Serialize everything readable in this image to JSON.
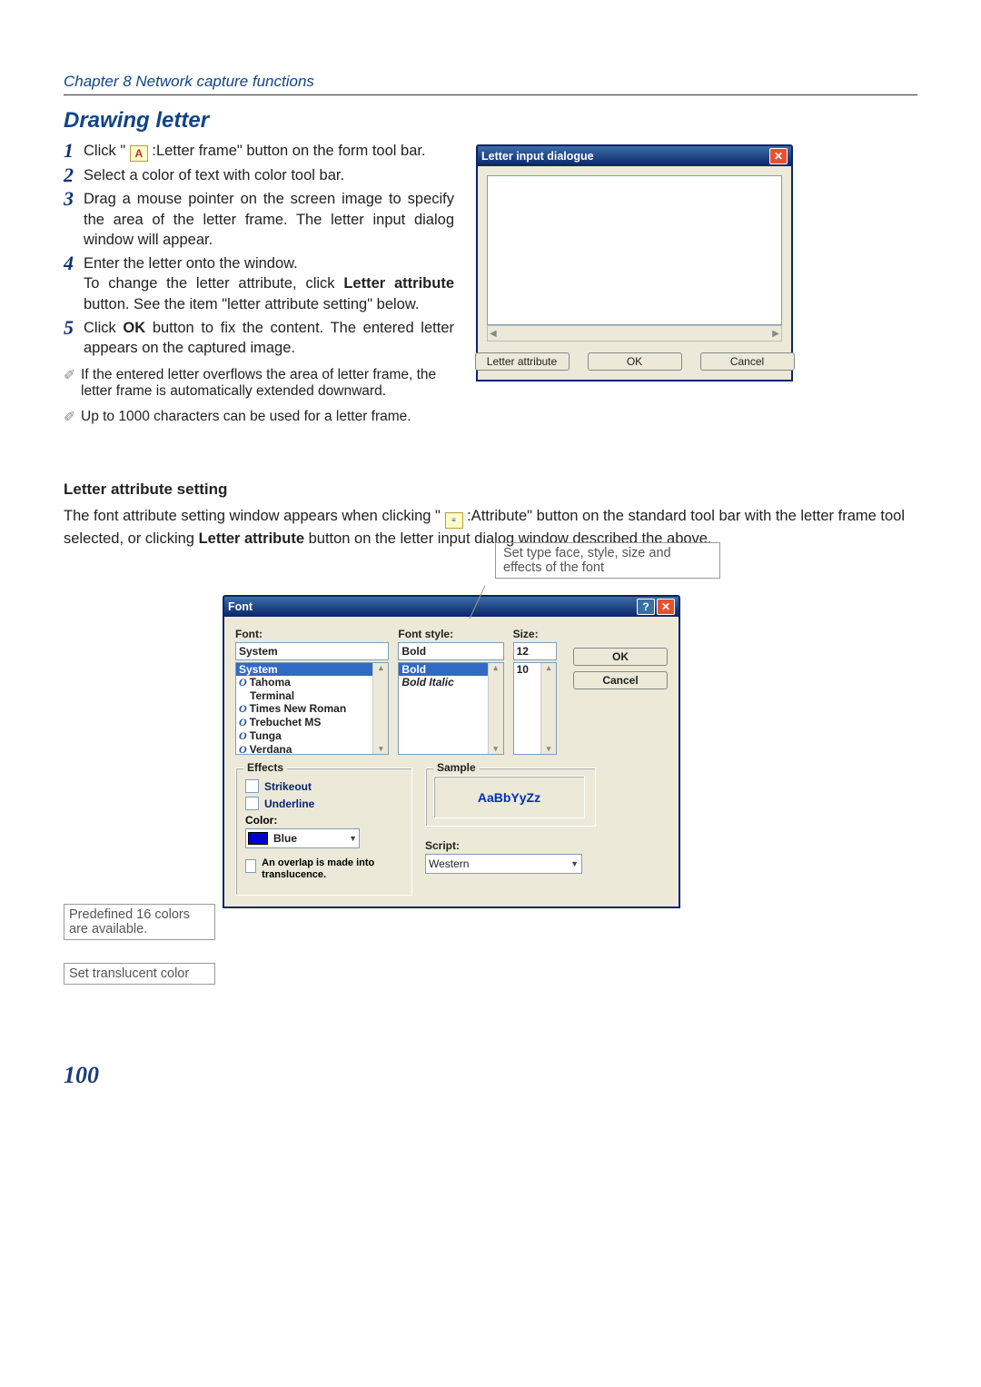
{
  "header": {
    "chapter": "Chapter 8 Network capture functions"
  },
  "section": {
    "title": "Drawing letter"
  },
  "steps": {
    "s1": {
      "n": "1",
      "pre": "Click \" ",
      "icon_letter": "A",
      "post1": " :Letter frame\" button on the form tool bar."
    },
    "s2": {
      "n": "2",
      "t": "Select a color of text with color tool bar."
    },
    "s3": {
      "n": "3",
      "t": "Drag a mouse pointer on the screen image to specify the area of the letter frame. The letter input dialog window will appear."
    },
    "s4": {
      "n": "4",
      "t1": "Enter the letter onto the window.",
      "t2a": "To change the letter attribute, click ",
      "bold": "Letter attribute",
      "t2b": " button. See the item \"letter attribute setting\" below."
    },
    "s5": {
      "n": "5",
      "t1": "Click ",
      "bold": "OK",
      "t2": " button to fix the content. The entered letter appears on the captured image."
    }
  },
  "notes": {
    "n1": "If the entered letter overflows the area of letter frame, the letter frame is automatically extended downward.",
    "n2": "Up to 1000 characters can be used for a letter frame."
  },
  "letter_dialog": {
    "title": "Letter input dialogue",
    "btn_attr": "Letter attribute",
    "btn_ok": "OK",
    "btn_cancel": "Cancel"
  },
  "subsection": {
    "title": "Letter attribute setting",
    "p1a": "The font attribute setting window appears when clicking \" ",
    "p1b": " :Attribute\" button on the standard tool bar with the letter frame tool selected, or clicking ",
    "p1bold": "Letter attribute",
    "p1c": " button on the letter input dialog window described the above."
  },
  "callouts": {
    "top": "Set type face, style, size and effects of the font",
    "colors": "Predefined 16 colors are available.",
    "trans": "Set translucent color"
  },
  "font_dialog": {
    "title": "Font",
    "font_label": "Font:",
    "font_value": "System",
    "font_list": [
      "System",
      "Tahoma",
      "Terminal",
      "Times New Roman",
      "Trebuchet MS",
      "Tunga",
      "Verdana"
    ],
    "style_label": "Font style:",
    "style_value": "Bold",
    "style_list": [
      "Bold",
      "Bold Italic"
    ],
    "size_label": "Size:",
    "size_value": "12",
    "size_list": [
      "10"
    ],
    "btn_ok": "OK",
    "btn_cancel": "Cancel",
    "effects_legend": "Effects",
    "strikeout": "Strikeout",
    "underline": "Underline",
    "color_label": "Color:",
    "color_value": "Blue",
    "overlap_note": "An overlap is made into translucence.",
    "sample_legend": "Sample",
    "sample_text": "AaBbYyZz",
    "script_label": "Script:",
    "script_value": "Western"
  },
  "page_number": "100"
}
